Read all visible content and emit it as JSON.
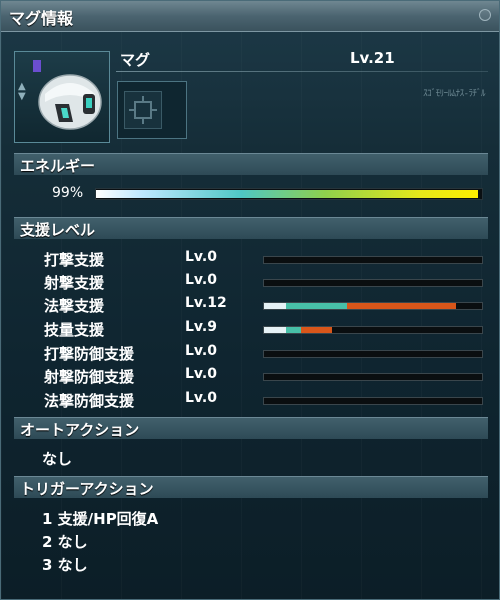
{
  "window": {
    "title": "マグ情報"
  },
  "mag": {
    "name": "マグ",
    "level": "Lv.21",
    "deco_text": "ｽｺﾞﾓﾘｰﾙﾑﾅｽ-ﾗﾁﾞﾙ"
  },
  "energy": {
    "header": "エネルギー",
    "value": "99%",
    "percent": 99
  },
  "support": {
    "header": "支援レベル",
    "rows": [
      {
        "label": "打撃支援",
        "level": "Lv.0",
        "white": 0,
        "teal": 0,
        "orange": 0
      },
      {
        "label": "射撃支援",
        "level": "Lv.0",
        "white": 0,
        "teal": 0,
        "orange": 0
      },
      {
        "label": "法撃支援",
        "level": "Lv.12",
        "white": 0.1,
        "teal": 0.38,
        "orange": 0.88
      },
      {
        "label": "技量支援",
        "level": "Lv.9",
        "white": 0.1,
        "teal": 0.17,
        "orange": 0.31
      },
      {
        "label": "打撃防御支援",
        "level": "Lv.0",
        "white": 0,
        "teal": 0,
        "orange": 0
      },
      {
        "label": "射撃防御支援",
        "level": "Lv.0",
        "white": 0,
        "teal": 0,
        "orange": 0
      },
      {
        "label": "法撃防御支援",
        "level": "Lv.0",
        "white": 0,
        "teal": 0,
        "orange": 0
      }
    ]
  },
  "auto_action": {
    "header": "オートアクション",
    "value": "なし"
  },
  "trigger_action": {
    "header": "トリガーアクション",
    "items": [
      "1 支援/HP回復A",
      "2 なし",
      "3 なし"
    ]
  },
  "colors": {
    "bar_white": "#e6f2f6",
    "bar_teal": "#48c0a8",
    "bar_orange": "#d8561a"
  }
}
